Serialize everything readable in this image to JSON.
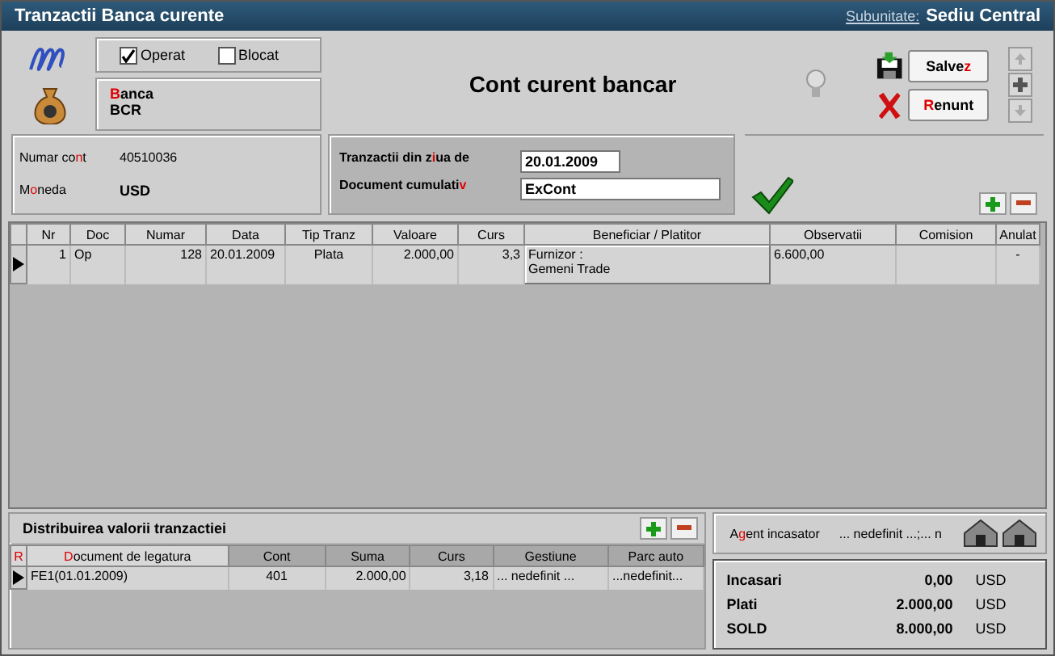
{
  "window": {
    "title": "Tranzactii Banca curente",
    "subunit_label": "Subunitate:",
    "subunit": "Sediu Central"
  },
  "flags": [
    {
      "label": "Operat",
      "checked": true
    },
    {
      "label": "Blocat",
      "checked": false
    }
  ],
  "bank": {
    "label": {
      "key": "B",
      "post": "anca"
    },
    "value": "BCR"
  },
  "heading": "Cont curent bancar",
  "buttons": [
    {
      "kind": "save",
      "label": {
        "pre": "Salve",
        "key": "z"
      }
    },
    {
      "kind": "cancel",
      "label": {
        "key": "R",
        "post": "enunt"
      }
    }
  ],
  "account": [
    {
      "label": {
        "pre": "Numar co",
        "key": "n",
        "post": "t"
      },
      "value": "40510036",
      "emphasis": false
    },
    {
      "label": {
        "pre": "M",
        "key": "o",
        "post": "neda"
      },
      "value": "USD",
      "emphasis": true
    }
  ],
  "filters": [
    {
      "label": {
        "pre": "Tranzactii din z",
        "key": "i",
        "post": "ua de"
      },
      "value": "20.01.2009"
    },
    {
      "label": {
        "pre": "Document cumulati",
        "key": "v"
      },
      "value": "ExCont"
    }
  ],
  "table": {
    "columns": [
      "Nr",
      "Doc",
      "Numar",
      "Data",
      "Tip Tranz",
      "Valoare",
      "Curs",
      "Beneficiar  / Platitor",
      "Observatii",
      "Comision",
      "Anulat"
    ],
    "rows": [
      {
        "selected": true,
        "cells": [
          "1",
          "Op",
          "128",
          "20.01.2009",
          "Plata",
          "2.000,00",
          "3,3",
          [
            "Furnizor :",
            "Gemeni Trade"
          ],
          "6.600,00",
          null,
          "-"
        ]
      }
    ]
  },
  "distribution": {
    "title": "Distribuirea valorii tranzactiei",
    "marker": "R",
    "columns": [
      {
        "key": "D",
        "post": "ocument de legatura"
      },
      {
        "pre": "Cont"
      },
      {
        "pre": "Suma"
      },
      {
        "pre": "Curs"
      },
      {
        "pre": "Gestiune"
      },
      {
        "pre": "Parc auto"
      }
    ],
    "rows": [
      {
        "selected": true,
        "cells": [
          "FE1(01.01.2009)",
          "401",
          "2.000,00",
          "3,18",
          "... nedefinit ...",
          "...nedefinit..."
        ]
      }
    ]
  },
  "agent": {
    "label": {
      "pre": "A",
      "key": "g",
      "post": "ent incasator"
    },
    "value": "... nedefinit ...;... n"
  },
  "totals": [
    {
      "label": "Incasari",
      "amount": "0,00",
      "currency": "USD"
    },
    {
      "label": "Plati",
      "amount": "2.000,00",
      "currency": "USD"
    },
    {
      "label": "SOLD",
      "amount": "8.000,00",
      "currency": "USD"
    }
  ]
}
